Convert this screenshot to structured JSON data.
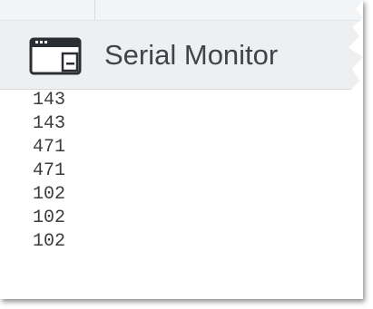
{
  "panel": {
    "title": "Serial Monitor",
    "icon": "serial-monitor-icon"
  },
  "output": {
    "lines": [
      "143",
      "143",
      "471",
      "471",
      "102",
      "102",
      "102"
    ]
  },
  "colors": {
    "header_bg": "#edeff1",
    "title_text": "#3f454b",
    "output_text": "#3c3c3c"
  }
}
